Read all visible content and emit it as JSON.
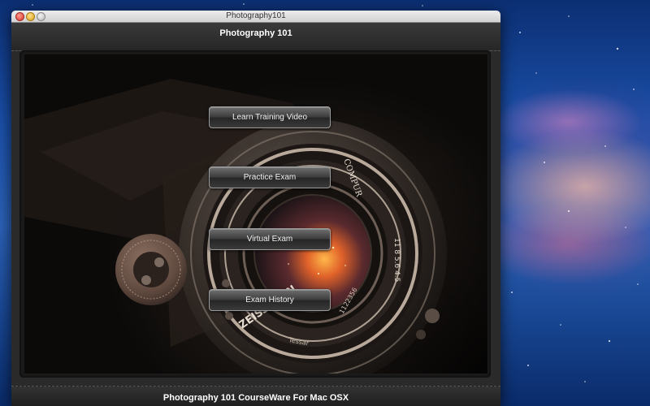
{
  "window": {
    "title": "Photography101",
    "controls": [
      "close-icon",
      "minimize-icon",
      "zoom-icon"
    ]
  },
  "header": {
    "title": "Photography 101"
  },
  "menu": {
    "buttons": [
      {
        "label": "Learn Training Video"
      },
      {
        "label": "Practice Exam"
      },
      {
        "label": "Virtual Exam"
      },
      {
        "label": "Exam History"
      }
    ]
  },
  "background_image": {
    "icon": "vintage-camera-lens-image",
    "lens_text": "ZEISS IKON",
    "shutter_text": "COMPUR",
    "serial_text": "1122356",
    "aperture_marks": "11 8 5.6 4.5",
    "lens_ring_text": "Tessar"
  },
  "footer": {
    "text": "Photography 101 CourseWare For Mac OSX"
  },
  "colors": {
    "desktop": "#1a4fa8",
    "window_chrome": "#2a2a2a",
    "button_text": "#f0f0f0"
  }
}
